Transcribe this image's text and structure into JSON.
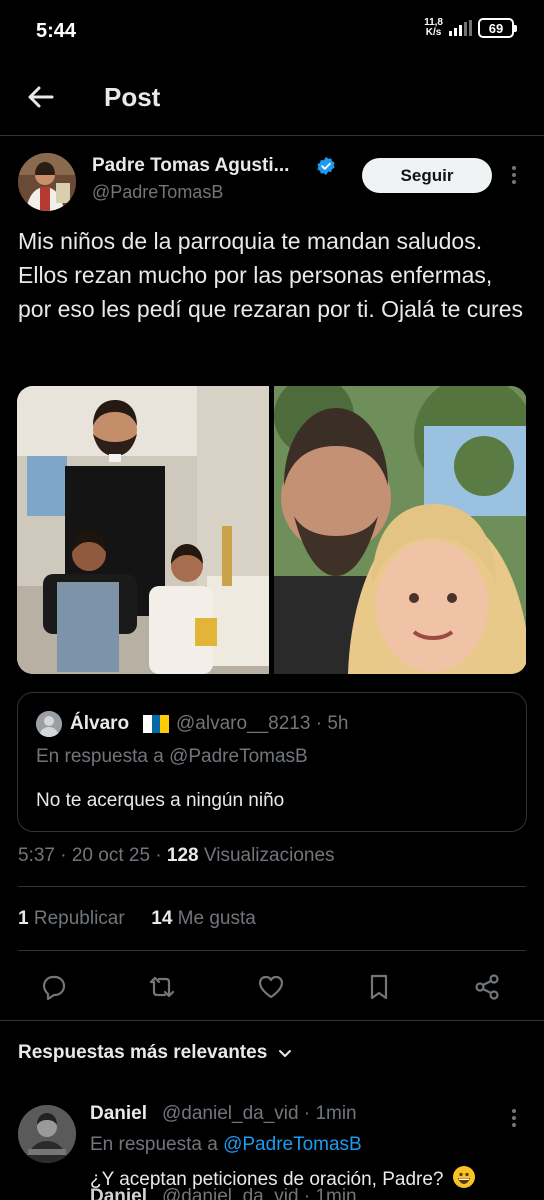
{
  "status_bar": {
    "time": "5:44",
    "net_speed_value": "11,8",
    "net_speed_unit": "K/s",
    "battery": "69"
  },
  "header": {
    "title": "Post"
  },
  "post": {
    "author_name": "Padre Tomas Agusti...",
    "author_handle": "@PadreTomasB",
    "follow_label": "Seguir",
    "text": "Mis niños de la parroquia te mandan saludos. Ellos rezan mucho por las personas enfermas, por eso les pedí que rezaran por ti. Ojalá te cures",
    "timestamp": "5:37 · 20 oct 25 · ",
    "views_count": "128",
    "views_label": " Visualizaciones",
    "reposts_count": "1",
    "reposts_label": " Republicar",
    "likes_count": "14",
    "likes_label": " Me gusta"
  },
  "quote": {
    "name": "Álvaro",
    "handle": "@alvaro__8213 · 5h",
    "reply_to": "En respuesta a @PadreTomasB",
    "text": "No te acerques a ningún niño"
  },
  "replies": {
    "heading": "Respuestas más relevantes",
    "items": [
      {
        "name": "Daniel",
        "handle": "@daniel_da_vid · 1min",
        "reply_prefix": "En respuesta a ",
        "reply_handle": "@PadreTomasB",
        "text": "¿Y aceptan peticiones de oración, Padre?"
      }
    ],
    "next_name": "Daniel",
    "next_handle": "@daniel_da_vid · 1min"
  },
  "colors": {
    "background": "#000000",
    "accent": "#1d9bf0",
    "text": "#e7e9ea",
    "muted": "#71767b",
    "border": "#2f3336"
  }
}
